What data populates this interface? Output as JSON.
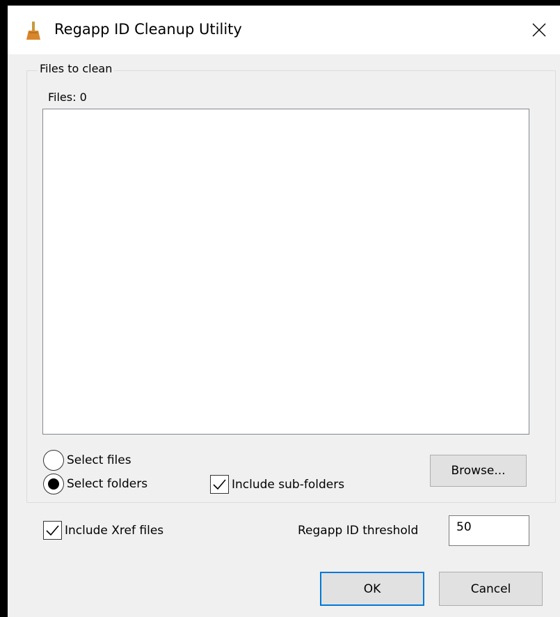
{
  "window": {
    "title": "Regapp ID Cleanup Utility",
    "icon": "broom-icon"
  },
  "files_group": {
    "label": "Files to clean",
    "files_count": "Files: 0",
    "files": []
  },
  "options": {
    "select_files": "Select files",
    "select_folders": "Select folders",
    "selected_mode": "Select folders",
    "include_subfolders": "Include sub-folders",
    "include_subfolders_checked": true,
    "browse": "Browse...",
    "include_xref": "Include Xref files",
    "include_xref_checked": true,
    "threshold_label": "Regapp ID threshold",
    "threshold_value": "50"
  },
  "buttons": {
    "ok": "OK",
    "cancel": "Cancel"
  },
  "colors": {
    "accent": "#0078d7",
    "window_bg": "#f0f0f0",
    "titlebar_bg": "#ffffff"
  }
}
